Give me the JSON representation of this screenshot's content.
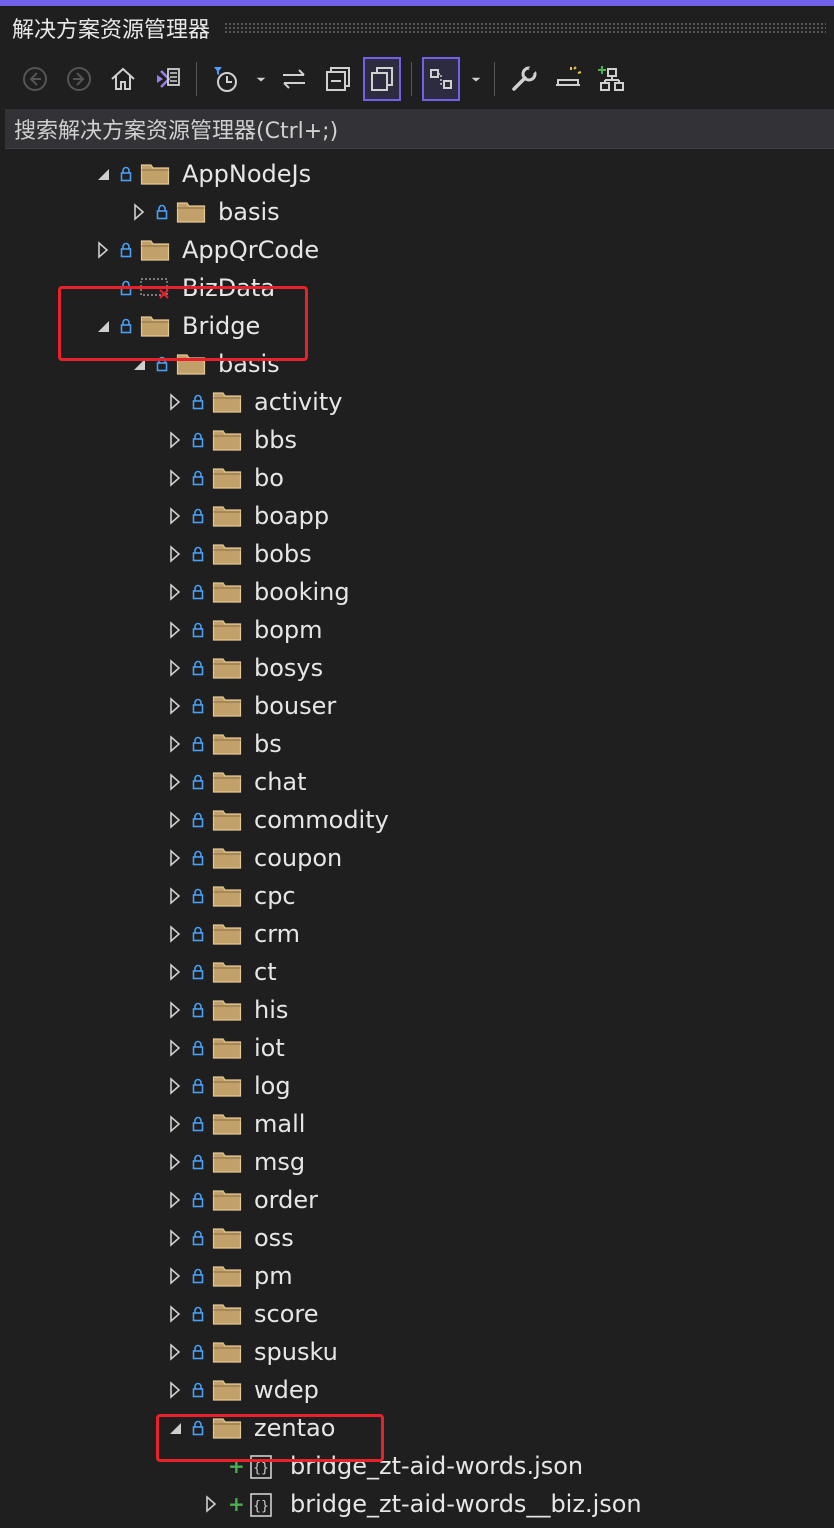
{
  "window": {
    "title": "解决方案资源管理器"
  },
  "toolbar": {
    "buttons": [
      {
        "icon": "back-arrow-icon"
      },
      {
        "icon": "forward-arrow-icon"
      },
      {
        "icon": "home-icon"
      },
      {
        "icon": "vs-solution-view-icon"
      },
      {
        "icon": "pending-changes-filter-icon"
      },
      {
        "icon": "dropdown-chevron-icon"
      },
      {
        "icon": "sync-active-document-icon"
      },
      {
        "icon": "collapse-all-icon"
      },
      {
        "icon": "show-all-files-icon"
      },
      {
        "icon": "preview-selected-items-icon"
      },
      {
        "icon": "dropdown-chevron-icon"
      },
      {
        "icon": "properties-wrench-icon"
      },
      {
        "icon": "git-changes-icon"
      },
      {
        "icon": "new-solution-explorer-view-icon"
      }
    ]
  },
  "search": {
    "placeholder": "搜索解决方案资源管理器(Ctrl+;)"
  },
  "tree": {
    "items": [
      {
        "label": "AppNodeJs",
        "expanded": true
      },
      {
        "label": "basis",
        "expanded": false
      },
      {
        "label": "AppQrCode",
        "expanded": false
      },
      {
        "label": "BizData",
        "missing": true
      },
      {
        "label": "Bridge",
        "expanded": true
      },
      {
        "label": "basis",
        "expanded": true
      },
      {
        "label": "activity"
      },
      {
        "label": "bbs"
      },
      {
        "label": "bo"
      },
      {
        "label": "boapp"
      },
      {
        "label": "bobs"
      },
      {
        "label": "booking"
      },
      {
        "label": "bopm"
      },
      {
        "label": "bosys"
      },
      {
        "label": "bouser"
      },
      {
        "label": "bs"
      },
      {
        "label": "chat"
      },
      {
        "label": "commodity"
      },
      {
        "label": "coupon"
      },
      {
        "label": "cpc"
      },
      {
        "label": "crm"
      },
      {
        "label": "ct"
      },
      {
        "label": "his"
      },
      {
        "label": "iot"
      },
      {
        "label": "log"
      },
      {
        "label": "mall"
      },
      {
        "label": "msg"
      },
      {
        "label": "order"
      },
      {
        "label": "oss"
      },
      {
        "label": "pm"
      },
      {
        "label": "score"
      },
      {
        "label": "spusku"
      },
      {
        "label": "wdep"
      },
      {
        "label": "zentao",
        "expanded": true
      },
      {
        "label": "bridge_zt-aid-words.json",
        "added": true
      },
      {
        "label": "bridge_zt-aid-words__biz.json",
        "added": true
      }
    ]
  },
  "colors": {
    "accent": "#7160e8",
    "highlight_box": "#e8212b",
    "folder": "#dcb67a",
    "lock": "#4b9ff5",
    "added": "#4caf50"
  }
}
